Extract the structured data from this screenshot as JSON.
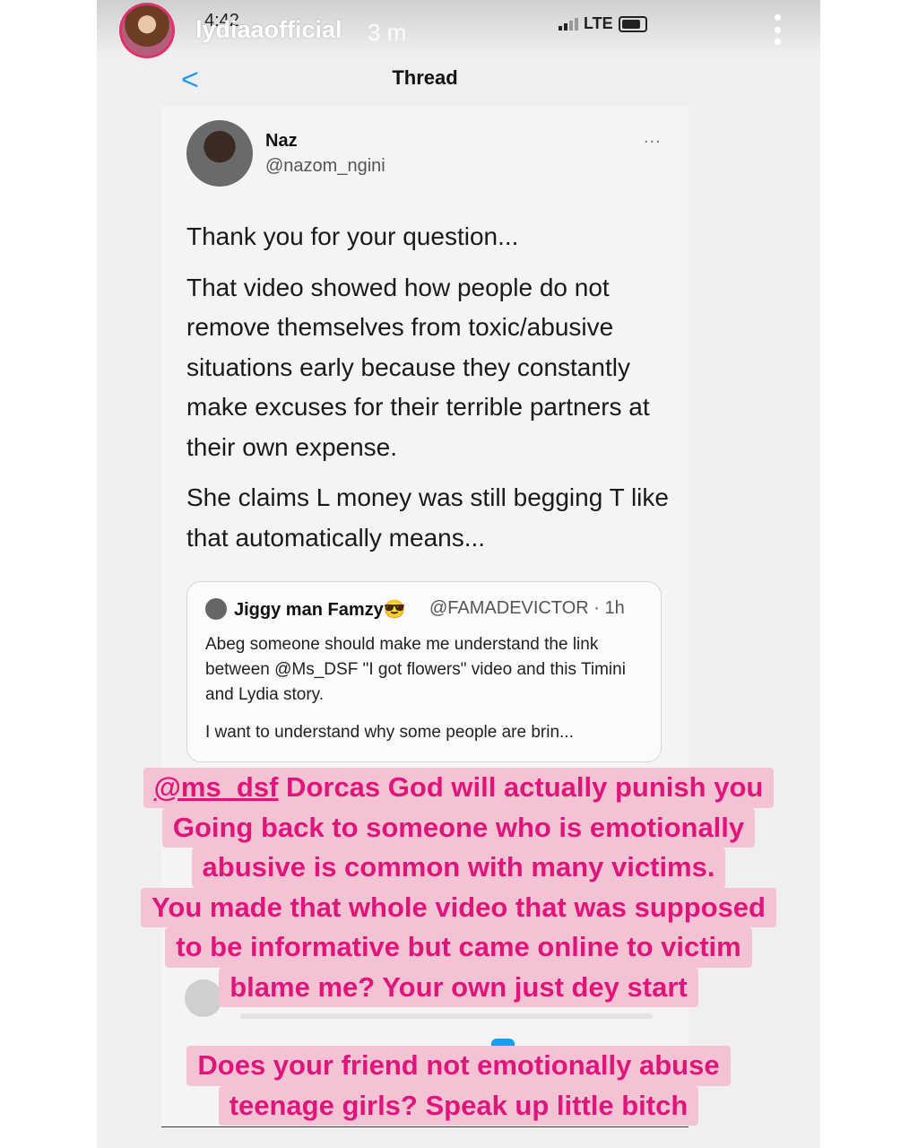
{
  "story": {
    "username": "lydiaaofficial",
    "time_ago": "3 m"
  },
  "status_bar": {
    "clock": "4:42",
    "network": "LTE"
  },
  "thread_nav": {
    "back_symbol": "<",
    "title": "Thread"
  },
  "tweet": {
    "name": "Naz",
    "handle": "@nazom_ngini",
    "more": "...",
    "paragraphs": [
      "Thank you for your question...",
      "That video showed how people do not remove themselves from toxic/abusive situations early because they constantly make excuses for their terrible partners at their own expense.",
      "She claims L money was still begging T like that automatically means..."
    ]
  },
  "quoted_tweet": {
    "name": "Jiggy man Famzy😎",
    "handle_time": "@FAMADEVICTOR · 1h",
    "paragraphs": [
      "Abeg someone should make me understand the link between @Ms_DSF \"I got flowers\" video and this Timini and Lydia story.",
      "I want to understand why some people are brin..."
    ]
  },
  "caption_1": {
    "mention": "@ms_dsf",
    "lines": [
      " Dorcas God will actually punish you",
      "Going back to someone who is emotionally",
      "abusive is common with many victims.",
      "You made that whole video that was supposed",
      "to be informative but came online to victim",
      "blame me? Your own just dey start"
    ]
  },
  "caption_2": {
    "lines": [
      "Does your friend not emotionally abuse",
      "teenage girls? Speak up little bitch"
    ]
  },
  "colors": {
    "caption_text": "#e0157c",
    "caption_bg": "#f3c3d4",
    "link_blue": "#1d9bf0"
  },
  "icons": {
    "back": "chevron-left-icon",
    "more": "ellipsis-icon",
    "story_menu": "vertical-dots-icon",
    "signal": "signal-bars-icon",
    "battery": "battery-icon"
  }
}
